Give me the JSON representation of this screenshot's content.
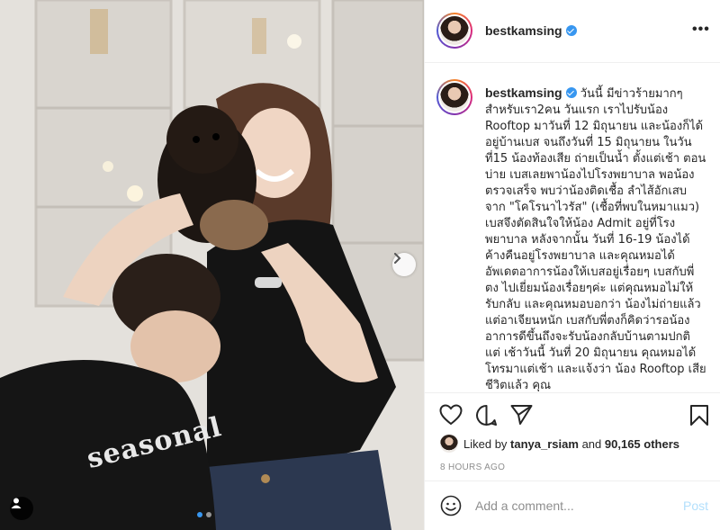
{
  "post": {
    "username": "bestkamsing",
    "verified": true,
    "more_icon": "more-horizontal-icon",
    "caption": "วันนี้ มีข่าวร้ายมากๆ สำหรับเรา2คน วันแรก เราไปรับน้อง Rooftop มาวันที่ 12 มิถุนายน และน้องก็ได้อยู่บ้านเบส จนถึงวันที่ 15 มิถุนายน ในวันที่15 น้องท้องเสีย ถ่ายเป็นน้ำ ตั้งแต่เช้า ตอนบ่าย เบสเลยพาน้องไปโรงพยาบาล พอน้องตรวจเสร็จ พบว่าน้องติดเชื้อ ลำไส้อักเสบจาก \"โคโรนาไวรัส\" (เชื้อที่พบในหมาแมว) เบสจึงตัดสินใจให้น้อง Admit อยู่ที่โรงพยาบาล หลังจากนั้น วันที่ 16-19 น้องได้ค้างคืนอยู่โรงพยาบาล และคุณหมอได้อัพเดตอาการน้องให้เบสอยู่เรื่อยๆ เบสกับพี่ตง ไปเยี่ยมน้องเรื่อยๆค่ะ แต่คุณหมอไม่ให้รับกลับ และคุณหมอบอกว่า น้องไม่ถ่ายแล้ว แต่อาเจียนหนัก เบสกับพี่ตงก็คิดว่ารอน้องอาการดีขึ้นถึงจะรับน้องกลับบ้านตามปกติ แต่ เช้าวันนี้ วันที่ 20 มิถุนายน คุณหมอได้โทรมาแต่เช้า และแจ้งว่า น้อง Rooftop เสียชีวิตแล้ว คุณ"
  },
  "photo": {
    "shirt_text": "seasonal",
    "next_icon": "chevron-right-icon",
    "tag_icon": "user-tag-icon",
    "slide_count": 2,
    "active_slide": 0
  },
  "actions": {
    "like_icon": "heart-icon",
    "comment_icon": "comment-bubble-icon",
    "share_icon": "paper-plane-icon",
    "save_icon": "bookmark-icon"
  },
  "likes": {
    "prefix": "Liked by",
    "user": "tanya_rsiam",
    "conjunction": "and",
    "others": "90,165 others"
  },
  "timestamp": "8 HOURS AGO",
  "comment_box": {
    "emoji_icon": "smiley-icon",
    "placeholder": "Add a comment...",
    "post_label": "Post"
  },
  "colors": {
    "verified": "#3897f0",
    "post_button": "#b2dffc",
    "muted_text": "#8e8e8e"
  }
}
